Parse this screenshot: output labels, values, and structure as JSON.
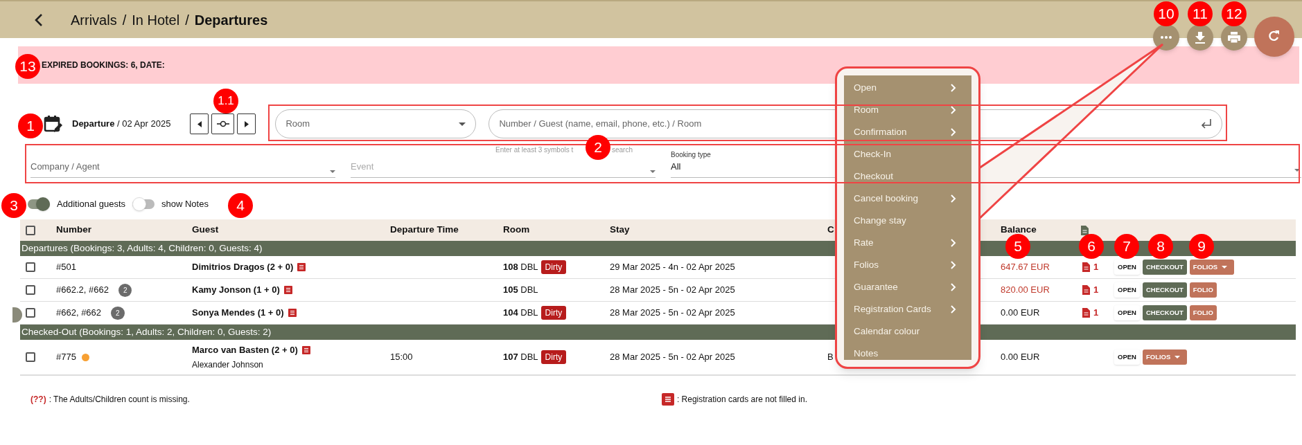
{
  "header": {
    "breadcrumb": [
      {
        "label": "Arrivals",
        "current": false
      },
      {
        "label": "In Hotel",
        "current": false
      },
      {
        "label": "Departures",
        "current": true
      }
    ],
    "separator": "/"
  },
  "toolbar_buttons": [
    {
      "kind": "more"
    },
    {
      "kind": "download"
    },
    {
      "kind": "print"
    },
    {
      "kind": "refresh"
    }
  ],
  "banner": {
    "text": "EXPIRED BOOKINGS: 6, DATE:"
  },
  "date_filter": {
    "text": "**Departure** / 02 Apr 2025"
  },
  "room_select": {
    "placeholder": "Room"
  },
  "search": {
    "placeholder": "Number / Guest (name, email, phone, etc.) / Room",
    "hint": "Enter at least 3 symbols t",
    "hint_tail": "search"
  },
  "filters": [
    {
      "placeholder": "Company / Agent"
    },
    {
      "placeholder": "Event"
    },
    {
      "label": "Booking type",
      "value": "All"
    }
  ],
  "toggles": [
    {
      "label": "Additional guests",
      "on": true
    },
    {
      "label": "show Notes",
      "on": false
    }
  ],
  "table": {
    "select_all_checked": false,
    "columns": [
      "Number",
      "Guest",
      "Departure Time",
      "Room",
      "Stay",
      "C",
      "Balance"
    ],
    "groups": [
      {
        "title": "Departures (Bookings: 3, Adults: 4, Children: 0, Guests: 4)",
        "rows": [
          {
            "checked": false,
            "number": "#501",
            "guest": "Dimitrios Dragos (2 + 0)",
            "room": "**108** DBL",
            "status": "Dirty",
            "stay": "29 Mar 2025 - 4n - 02 Apr 2025",
            "balance": "647.67 EUR",
            "outstanding": true,
            "documents": "1",
            "actions": [
              {
                "kind": "open",
                "label": "OPEN"
              },
              {
                "kind": "checkout",
                "label": "CHECKOUT"
              },
              {
                "kind": "folios",
                "label": "FOLIOS"
              }
            ]
          },
          {
            "checked": false,
            "number": "#662.2, #662",
            "count": "2",
            "guest": "Kamy Jonson (1 + 0)",
            "room": "**105** DBL",
            "stay": "28 Mar 2025 - 5n - 02 Apr 2025",
            "balance": "820.00 EUR",
            "outstanding": true,
            "documents": "1",
            "actions": [
              {
                "kind": "open",
                "label": "OPEN"
              },
              {
                "kind": "checkout",
                "label": "CHECKOUT"
              },
              {
                "kind": "folio",
                "label": "FOLIO"
              }
            ]
          },
          {
            "checked": false,
            "number": "#662, #662",
            "count": "2",
            "guest": "Sonya Mendes (1 + 0)",
            "room": "**104** DBL",
            "status": "Dirty",
            "stay": "28 Mar 2025 - 5n - 02 Apr 2025",
            "balance": "0.00 EUR",
            "outstanding": false,
            "documents": "1",
            "actions": [
              {
                "kind": "open",
                "label": "OPEN"
              },
              {
                "kind": "checkout",
                "label": "CHECKOUT"
              },
              {
                "kind": "folio",
                "label": "FOLIO"
              }
            ]
          }
        ]
      },
      {
        "title": "Checked-Out (Bookings: 1, Adults: 2, Children: 0, Guests: 2)",
        "rows": [
          {
            "checked": false,
            "number": "#775",
            "color": "#f7a033",
            "guest": "Marco van Basten (2 + 0)",
            "extra_guest": "Alexander Johnson",
            "departure_time": "15:00",
            "room": "**107** DBL",
            "status": "Dirty",
            "stay": "28 Mar 2025 - 5n - 02 Apr 2025",
            "company": "B",
            "balance": "0.00 EUR",
            "outstanding": false,
            "actions": [
              {
                "kind": "open",
                "label": "OPEN"
              },
              {
                "kind": "folios",
                "label": "FOLIOS"
              }
            ]
          }
        ]
      }
    ]
  },
  "menu": {
    "items": [
      {
        "label": "Open",
        "submenu": true
      },
      {
        "label": "Room",
        "submenu": true
      },
      {
        "label": "Confirmation",
        "submenu": true
      },
      {
        "label": "Check-In",
        "submenu": false
      },
      {
        "label": "Checkout",
        "submenu": false
      },
      {
        "label": "Cancel booking",
        "submenu": true
      },
      {
        "label": "Change stay",
        "submenu": false
      },
      {
        "label": "Rate",
        "submenu": true
      },
      {
        "label": "Folios",
        "submenu": true
      },
      {
        "label": "Guarantee",
        "submenu": true
      },
      {
        "label": "Registration Cards",
        "submenu": true
      },
      {
        "label": "Calendar colour",
        "submenu": false
      },
      {
        "label": "Notes",
        "submenu": false
      }
    ]
  },
  "legend": [
    {
      "kind": "mark",
      "mark": "(??)",
      "text": ": The Adults/Children count is missing."
    },
    {
      "kind": "icon",
      "text": ": Registration cards are not filled in."
    }
  ],
  "annotations": [
    {
      "label": "1"
    },
    {
      "label": "1.1"
    },
    {
      "label": "2"
    },
    {
      "label": "3"
    },
    {
      "label": "4"
    },
    {
      "label": "5"
    },
    {
      "label": "6"
    },
    {
      "label": "7"
    },
    {
      "label": "8"
    },
    {
      "label": "9"
    },
    {
      "label": "10"
    },
    {
      "label": "11"
    },
    {
      "label": "12"
    },
    {
      "label": "13"
    }
  ]
}
